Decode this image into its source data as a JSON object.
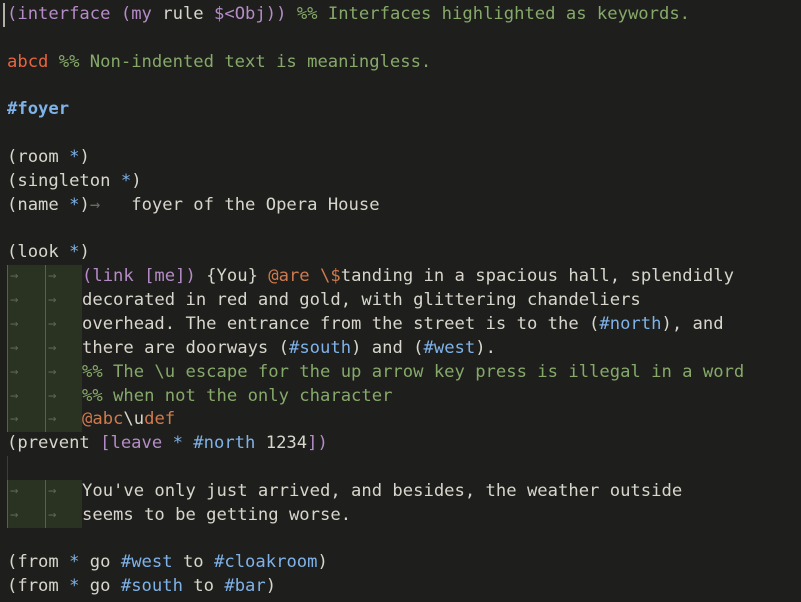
{
  "colors": {
    "background": "#1e1f1c",
    "text": "#d8d6cc",
    "comment": "#86a96a",
    "keyword": "#b58bc8",
    "tag": "#7fb2e9",
    "error": "#e8643e",
    "code": "#cf7a4e",
    "whitespace_dot": "#6a6c63"
  },
  "icons": {
    "indent_arrow": "tab-arrow-icon",
    "cursor": "text-cursor-icon"
  },
  "lines": [
    {
      "tokens": [
        {
          "t": "(interface",
          "c": "keyword"
        },
        {
          "t": " ",
          "c": "text"
        },
        {
          "t": "(my",
          "c": "keyword"
        },
        {
          "t": " ",
          "c": "text"
        },
        {
          "t": "rule",
          "c": "text"
        },
        {
          "t": " ",
          "c": "text"
        },
        {
          "t": "$<Obj))",
          "c": "keyword"
        },
        {
          "t": " ",
          "c": "text"
        },
        {
          "t": "%% Interfaces highlighted as keywords.",
          "c": "comment"
        }
      ],
      "cursor": true
    },
    {
      "tokens": []
    },
    {
      "tokens": [
        {
          "t": "abcd",
          "c": "error"
        },
        {
          "t": " ",
          "c": "text"
        },
        {
          "t": "%% Non-indented text is meaningless.",
          "c": "comment"
        }
      ]
    },
    {
      "tokens": []
    },
    {
      "tokens": [
        {
          "t": "#foyer",
          "c": "tag",
          "b": true
        }
      ]
    },
    {
      "tokens": []
    },
    {
      "tokens": [
        {
          "t": "(room ",
          "c": "text"
        },
        {
          "t": "*",
          "c": "tag"
        },
        {
          "t": ")",
          "c": "text"
        }
      ]
    },
    {
      "tokens": [
        {
          "t": "(singleton ",
          "c": "text"
        },
        {
          "t": "*",
          "c": "tag"
        },
        {
          "t": ")",
          "c": "text"
        }
      ]
    },
    {
      "tokens": [
        {
          "t": "(name ",
          "c": "text"
        },
        {
          "t": "*",
          "c": "tag"
        },
        {
          "t": ")",
          "c": "text"
        },
        {
          "t": "→",
          "c": "whitespace_dot",
          "tab": true
        },
        {
          "t": "   foyer of the Opera House",
          "c": "text"
        }
      ]
    },
    {
      "tokens": []
    },
    {
      "tokens": [
        {
          "t": "(look ",
          "c": "text"
        },
        {
          "t": "*",
          "c": "tag"
        },
        {
          "t": ")",
          "c": "text"
        }
      ]
    },
    {
      "indent": true,
      "tokens": [
        {
          "t": "(link [me])",
          "c": "keyword"
        },
        {
          "t": " {You} ",
          "c": "text"
        },
        {
          "t": "@are",
          "c": "code"
        },
        {
          "t": " ",
          "c": "text"
        },
        {
          "t": "\\$",
          "c": "code"
        },
        {
          "t": "tanding in a spacious hall, splendidly",
          "c": "text"
        }
      ]
    },
    {
      "indent": true,
      "tokens": [
        {
          "t": "decorated in red and gold, with glittering chandeliers",
          "c": "text"
        }
      ]
    },
    {
      "indent": true,
      "tokens": [
        {
          "t": "overhead. The entrance from the street is to the (",
          "c": "text"
        },
        {
          "t": "#north",
          "c": "tag"
        },
        {
          "t": "), and",
          "c": "text"
        }
      ]
    },
    {
      "indent": true,
      "tokens": [
        {
          "t": "there are doorways (",
          "c": "text"
        },
        {
          "t": "#south",
          "c": "tag"
        },
        {
          "t": ") and (",
          "c": "text"
        },
        {
          "t": "#west",
          "c": "tag"
        },
        {
          "t": ").",
          "c": "text"
        }
      ]
    },
    {
      "indent": true,
      "tokens": [
        {
          "t": "%% The \\u escape for the up arrow key press is illegal in a word",
          "c": "comment"
        }
      ]
    },
    {
      "indent": true,
      "tokens": [
        {
          "t": "%% when not the only character",
          "c": "comment"
        }
      ]
    },
    {
      "indent": true,
      "tokens": [
        {
          "t": "@abc",
          "c": "code"
        },
        {
          "t": "\\u",
          "c": "text"
        },
        {
          "t": "def",
          "c": "code"
        }
      ]
    },
    {
      "tokens": [
        {
          "t": "(prevent ",
          "c": "text"
        },
        {
          "t": "[leave ",
          "c": "keyword"
        },
        {
          "t": "* #north",
          "c": "tag"
        },
        {
          "t": " 1234",
          "c": "text"
        },
        {
          "t": "])",
          "c": "keyword"
        }
      ]
    },
    {
      "gutterbar": true,
      "tokens": []
    },
    {
      "indent": true,
      "tokens": [
        {
          "t": "You've only just arrived, and besides, the weather outside",
          "c": "text"
        }
      ]
    },
    {
      "indent": true,
      "tokens": [
        {
          "t": "seems to be getting worse.",
          "c": "text"
        }
      ]
    },
    {
      "tokens": []
    },
    {
      "tokens": [
        {
          "t": "(from ",
          "c": "text"
        },
        {
          "t": "*",
          "c": "tag"
        },
        {
          "t": " go ",
          "c": "text"
        },
        {
          "t": "#west",
          "c": "tag"
        },
        {
          "t": " to ",
          "c": "text"
        },
        {
          "t": "#cloakroom",
          "c": "tag"
        },
        {
          "t": ")",
          "c": "text"
        }
      ]
    },
    {
      "tokens": [
        {
          "t": "(from ",
          "c": "text"
        },
        {
          "t": "*",
          "c": "tag"
        },
        {
          "t": " go ",
          "c": "text"
        },
        {
          "t": "#south",
          "c": "tag"
        },
        {
          "t": " to ",
          "c": "text"
        },
        {
          "t": "#bar",
          "c": "tag"
        },
        {
          "t": ")",
          "c": "text"
        }
      ]
    }
  ]
}
